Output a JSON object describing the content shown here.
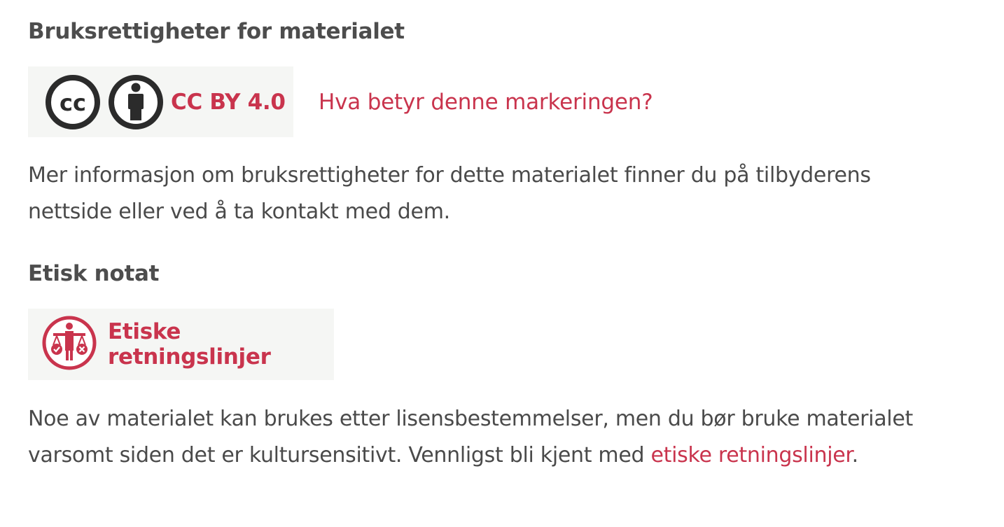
{
  "rights": {
    "heading": "Bruksrettigheter for materialet",
    "license_label": "CC BY 4.0",
    "license_help_link": "Hva betyr denne markeringen?",
    "description": "Mer informasjon om bruksrettigheter for dette materialet finner du på tilbyderens nettside eller ved å ta kontakt med dem.",
    "icons": [
      "cc-icon",
      "attribution-person-icon"
    ]
  },
  "ethics": {
    "heading": "Etisk notat",
    "guidelines_button": "Etiske retningslinjer",
    "icon": "ethics-scale-icon",
    "note_text": "Noe av materialet kan brukes etter lisensbestemmelser, men du bør bruke materialet varsomt siden det er kultursensitivt. Vennligst bli kjent med ",
    "note_link": "etiske retningslinjer",
    "note_end": "."
  },
  "colors": {
    "accent": "#c9344d",
    "text": "#4a4a4a",
    "box_bg": "#f5f6f4"
  }
}
